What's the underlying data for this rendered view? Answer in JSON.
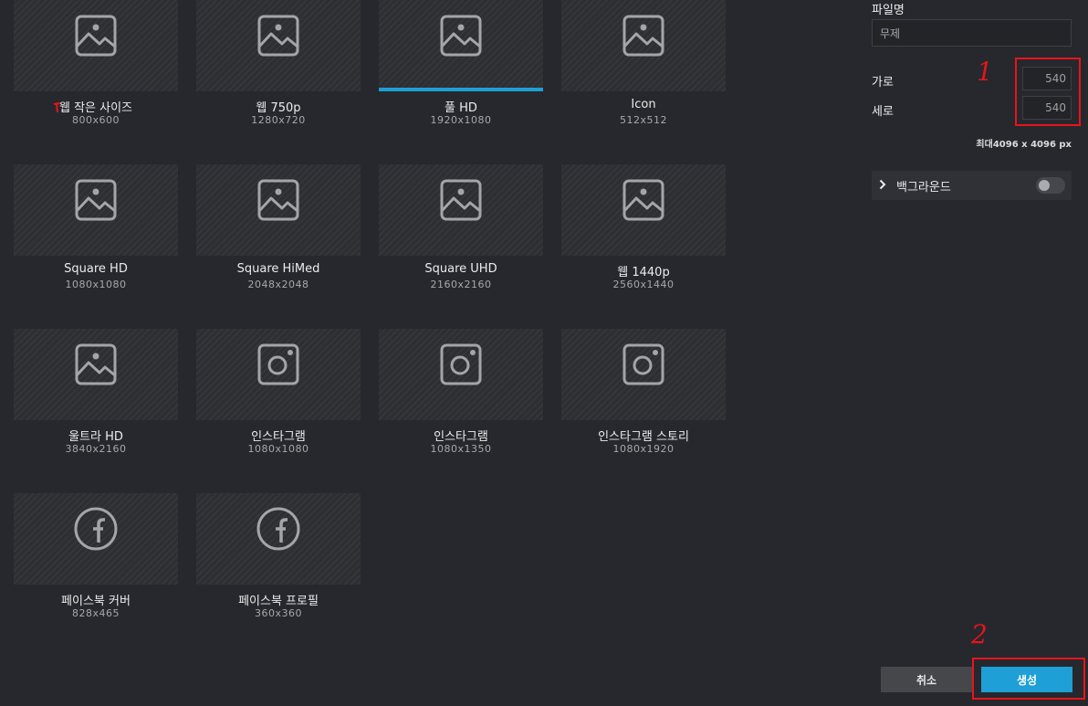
{
  "presets": [
    {
      "name": "웹 작은 사이즈",
      "size": "800x600",
      "icon": "image-icon",
      "selected": false
    },
    {
      "name": "웹 750p",
      "size": "1280x720",
      "icon": "image-icon",
      "selected": false
    },
    {
      "name": "풀 HD",
      "size": "1920x1080",
      "icon": "image-icon",
      "selected": true
    },
    {
      "name": "Icon",
      "size": "512x512",
      "icon": "image-icon",
      "selected": false
    },
    {
      "name": "Square HD",
      "size": "1080x1080",
      "icon": "image-icon",
      "selected": false
    },
    {
      "name": "Square HiMed",
      "size": "2048x2048",
      "icon": "image-icon",
      "selected": false
    },
    {
      "name": "Square UHD",
      "size": "2160x2160",
      "icon": "image-icon",
      "selected": false
    },
    {
      "name": "웹 1440p",
      "size": "2560x1440",
      "icon": "image-icon",
      "selected": false
    },
    {
      "name": "울트라 HD",
      "size": "3840x2160",
      "icon": "image-icon",
      "selected": false
    },
    {
      "name": "인스타그램",
      "size": "1080x1080",
      "icon": "instagram-icon",
      "selected": false
    },
    {
      "name": "인스타그램",
      "size": "1080x1350",
      "icon": "instagram-icon",
      "selected": false
    },
    {
      "name": "인스타그램 스토리",
      "size": "1080x1920",
      "icon": "instagram-icon",
      "selected": false
    },
    {
      "name": "페이스북 커버",
      "size": "828x465",
      "icon": "facebook-icon",
      "selected": false
    },
    {
      "name": "페이스북 프로필",
      "size": "360x360",
      "icon": "facebook-icon",
      "selected": false
    }
  ],
  "panel": {
    "filename_label": "파일명",
    "filename_value": "무제",
    "width_label": "가로",
    "width_value": "540",
    "height_label": "세로",
    "height_value": "540",
    "max_note": "최대4096 x 4096 px",
    "background_label": "백그라운드",
    "background_enabled": false
  },
  "buttons": {
    "cancel": "취소",
    "create": "생성"
  },
  "annotations": {
    "mark_1": "1",
    "mark_2": "2",
    "color": "#e8141b"
  },
  "colors": {
    "accent": "#1e9fd6",
    "background": "#26282d"
  }
}
